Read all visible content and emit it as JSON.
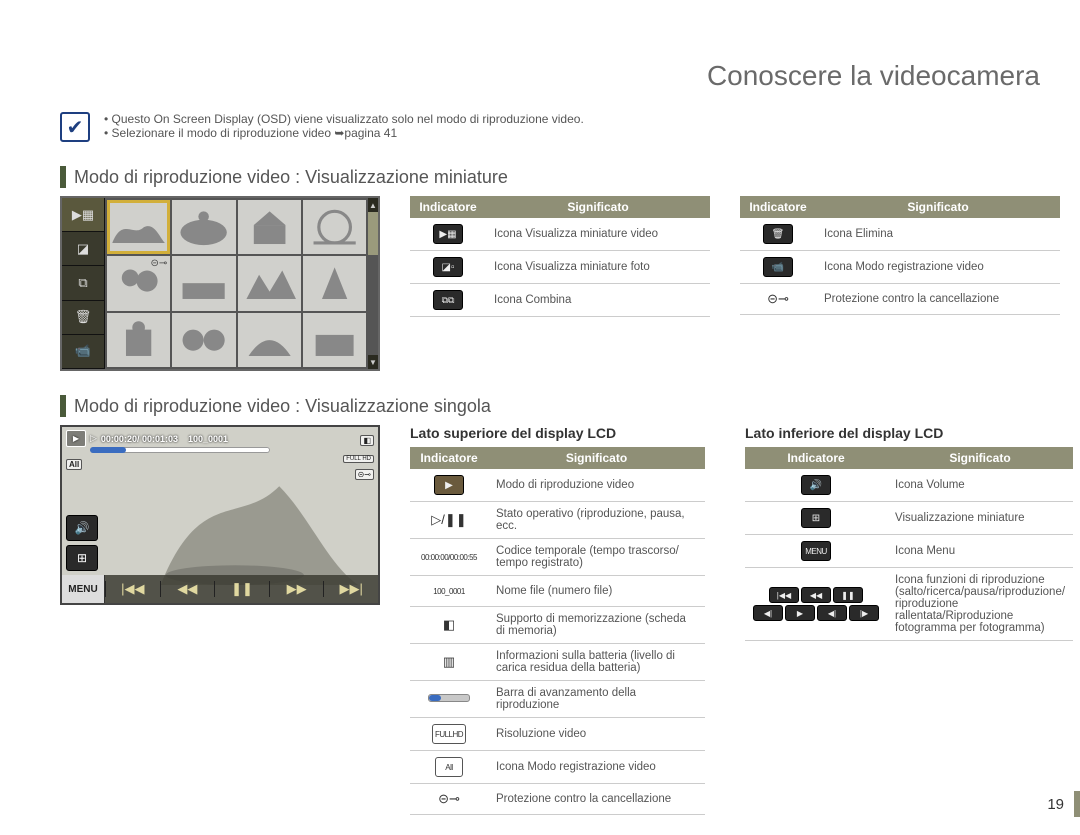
{
  "page_number": "19",
  "title": "Conoscere la videocamera",
  "notes": [
    "Questo On Screen Display (OSD) viene visualizzato solo nel modo di riproduzione video.",
    "Selezionare il modo di riproduzione video ➥pagina 41"
  ],
  "section1": {
    "heading": "Modo di riproduzione video : Visualizzazione miniature",
    "table_header": {
      "ind": "Indicatore",
      "sig": "Significato"
    },
    "left_table": [
      {
        "icon": "video-thumb-icon",
        "glyph": "▶▦",
        "text": "Icona Visualizza miniature video"
      },
      {
        "icon": "photo-thumb-icon",
        "glyph": "◪▫",
        "text": "Icona Visualizza miniature foto"
      },
      {
        "icon": "combine-icon",
        "glyph": "⧉⧉",
        "text": "Icona Combina"
      }
    ],
    "right_table": [
      {
        "icon": "delete-icon",
        "glyph": "🗑",
        "text": "Icona Elimina"
      },
      {
        "icon": "rec-mode-icon",
        "glyph": "📹",
        "text": "Icona Modo registrazione video"
      },
      {
        "icon": "protect-icon",
        "glyph": "⊝⊸",
        "plain": true,
        "text": "Protezione contro la cancellazione"
      }
    ]
  },
  "section2": {
    "heading": "Modo di riproduzione video : Visualizzazione singola",
    "osd": {
      "timecode": "00:00:20/ 00:01:03",
      "filenum": "100_0001",
      "storage": "◧",
      "resolution": "FULL HD",
      "rec_mode": "All",
      "protect": "⊝⊸",
      "menu_label": "MENU",
      "transport": [
        "|◀◀",
        "◀◀",
        "❚❚",
        "▶▶",
        "▶▶|"
      ],
      "vol_icon": "🔊",
      "thumb_icon": "⊞"
    },
    "upper": {
      "heading": "Lato superiore del display LCD",
      "rows": [
        {
          "icon": "play-mode-icon",
          "glyph": "▶",
          "style": "box",
          "text": "Modo di riproduzione video"
        },
        {
          "icon": "state-icon",
          "glyph": "▷/❚❚",
          "style": "plain",
          "text": "Stato operativo (riproduzione, pausa, ecc."
        },
        {
          "icon": "timecode-icon",
          "glyph": "00:00:00/00:00:55",
          "style": "key",
          "text": "Codice temporale (tempo trascorso/ tempo registrato)"
        },
        {
          "icon": "file-icon",
          "glyph": "100_0001",
          "style": "key",
          "text": "Nome file (numero file)"
        },
        {
          "icon": "storage-icon",
          "glyph": "◧",
          "style": "plain",
          "text": "Supporto di memorizzazione (scheda di memoria)"
        },
        {
          "icon": "battery-icon",
          "glyph": "▥",
          "style": "plain",
          "text": "Informazioni sulla batteria (livello di carica residua della batteria)"
        },
        {
          "icon": "progress-icon",
          "glyph": "",
          "style": "none",
          "text": "Barra di avanzamento della riproduzione"
        },
        {
          "icon": "res-icon",
          "glyph": "FULLHD",
          "style": "key",
          "text": "Risoluzione video"
        },
        {
          "icon": "recmode-icon",
          "glyph": "All",
          "style": "key",
          "text": "Icona Modo registrazione video"
        },
        {
          "icon": "protect-icon",
          "glyph": "⊝⊸",
          "style": "plain",
          "text": "Protezione contro la cancellazione"
        }
      ]
    },
    "lower": {
      "heading": "Lato inferiore del display LCD",
      "rows": [
        {
          "icon": "volume-icon",
          "glyph": "🔊",
          "text": "Icona Volume"
        },
        {
          "icon": "thumbview-icon",
          "glyph": "⊞",
          "text": "Visualizzazione miniature"
        },
        {
          "icon": "menu-icon",
          "glyph": "MENU",
          "key": true,
          "text": "Icona Menu"
        },
        {
          "icon": "transport-icons",
          "stack": true,
          "row1": [
            "|◀◀",
            "◀◀",
            "❚❚"
          ],
          "row2": [
            "◀|",
            "▶",
            "◀|",
            "|▶"
          ],
          "text": "Icona funzioni di riproduzione (salto/ricerca/pausa/riproduzione/ riproduzione rallentata/Riproduzione fotogramma per fotogramma)"
        }
      ]
    }
  }
}
